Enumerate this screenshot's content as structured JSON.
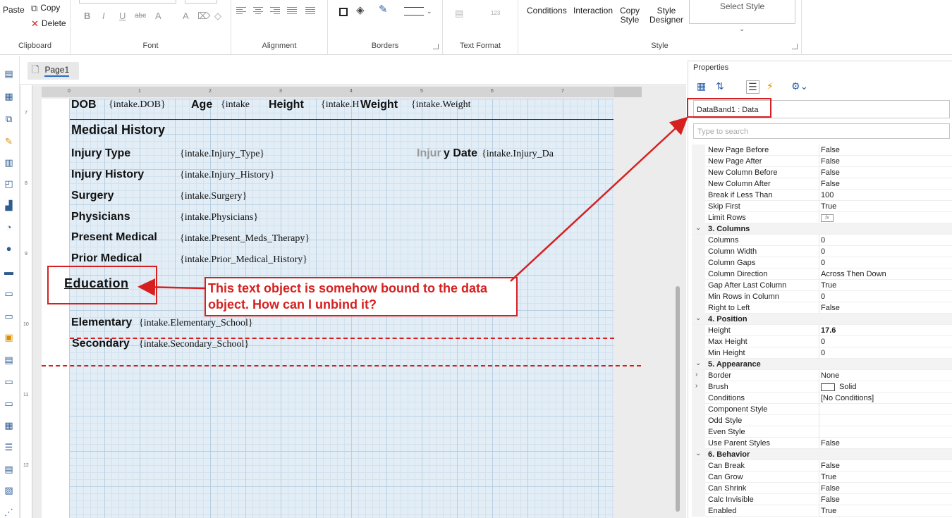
{
  "ribbon": {
    "clipboard": {
      "paste": "Paste",
      "copy": "Copy",
      "delete": "Delete",
      "label": "Clipboard"
    },
    "font": {
      "label": "Font"
    },
    "alignment": {
      "label": "Alignment"
    },
    "borders": {
      "label": "Borders"
    },
    "text_format": {
      "label": "Text Format",
      "num_badge": "123"
    },
    "style": {
      "conditions": "Conditions",
      "interaction": "Interaction",
      "copy_style_1": "Copy",
      "copy_style_2": "Style",
      "style_designer_1": "Style",
      "style_designer_2": "Designer",
      "select_style": "Select Style",
      "label": "Style"
    }
  },
  "document": {
    "tab": "Page1"
  },
  "rulers": {
    "horizontal": [
      "0",
      "1",
      "2",
      "3",
      "4",
      "5",
      "6",
      "7"
    ],
    "vertical": [
      "7",
      "8",
      "9",
      "10",
      "11",
      "12"
    ]
  },
  "report": {
    "row1": {
      "dob": "DOB",
      "dob_field": "{intake.DOB}",
      "age": "Age",
      "age_field": "{intake",
      "height": "Height",
      "height_field": "{intake.H",
      "weight": "Weight",
      "weight_field": "{intake.Weight"
    },
    "medical_history": "Medical History",
    "injury_type": "Injury Type",
    "injury_type_field": "{intake.Injury_Type}",
    "injury_date_label_prefix": "Injur",
    "injury_date_label": "y Date",
    "injury_date_field": "{intake.Injury_Da",
    "injury_history": "Injury History",
    "injury_history_field": "{intake.Injury_History}",
    "surgery": "Surgery",
    "surgery_field": "{intake.Surgery}",
    "physicians": "Physicians",
    "physicians_field": "{intake.Physicians}",
    "present_medical": "Present Medical",
    "present_medical_field": "{intake.Present_Meds_Therapy}",
    "prior_medical": "Prior Medical",
    "prior_medical_field": "{intake.Prior_Medical_History}",
    "education": "Education",
    "elementary": "Elementary",
    "elementary_field": "{intake.Elementary_School}",
    "secondary": "Secondary",
    "secondary_field": "{intake.Secondary_School}"
  },
  "annotation": {
    "callout_line1": "This text object is somehow bound to the data",
    "callout_line2": "object. How can I unbind it?",
    "color": "#d62020"
  },
  "properties": {
    "title": "Properties",
    "selector": "DataBand1 : Data",
    "search_placeholder": "Type to search",
    "rows": [
      {
        "name": "New Page Before",
        "value": "False"
      },
      {
        "name": "New Page After",
        "value": "False"
      },
      {
        "name": "New Column Before",
        "value": "False"
      },
      {
        "name": "New Column After",
        "value": "False"
      },
      {
        "name": "Break if Less Than",
        "value": "100"
      },
      {
        "name": "Skip First",
        "value": "True"
      },
      {
        "name": "Limit Rows",
        "value": ""
      },
      {
        "category": "3. Columns"
      },
      {
        "name": "Columns",
        "value": "0"
      },
      {
        "name": "Column Width",
        "value": "0"
      },
      {
        "name": "Column Gaps",
        "value": "0"
      },
      {
        "name": "Column Direction",
        "value": "Across Then Down"
      },
      {
        "name": "Gap After Last Column",
        "value": "True"
      },
      {
        "name": "Min Rows in Column",
        "value": "0"
      },
      {
        "name": "Right to Left",
        "value": "False"
      },
      {
        "category": "4. Position"
      },
      {
        "name": "Height",
        "value": "17.6"
      },
      {
        "name": "Max Height",
        "value": "0"
      },
      {
        "name": "Min Height",
        "value": "0"
      },
      {
        "category": "5. Appearance"
      },
      {
        "name": "Border",
        "value": "None"
      },
      {
        "name": "Brush",
        "value": "Solid"
      },
      {
        "name": "Conditions",
        "value": "[No Conditions]"
      },
      {
        "name": "Component Style",
        "value": ""
      },
      {
        "name": "Odd Style",
        "value": ""
      },
      {
        "name": "Even Style",
        "value": ""
      },
      {
        "name": "Use Parent Styles",
        "value": "False"
      },
      {
        "category": "6. Behavior"
      },
      {
        "name": "Can Break",
        "value": "False"
      },
      {
        "name": "Can Grow",
        "value": "True"
      },
      {
        "name": "Can Shrink",
        "value": "False"
      },
      {
        "name": "Calc Invisible",
        "value": "False"
      },
      {
        "name": "Enabled",
        "value": "True"
      }
    ],
    "fx_badge": "fx"
  }
}
